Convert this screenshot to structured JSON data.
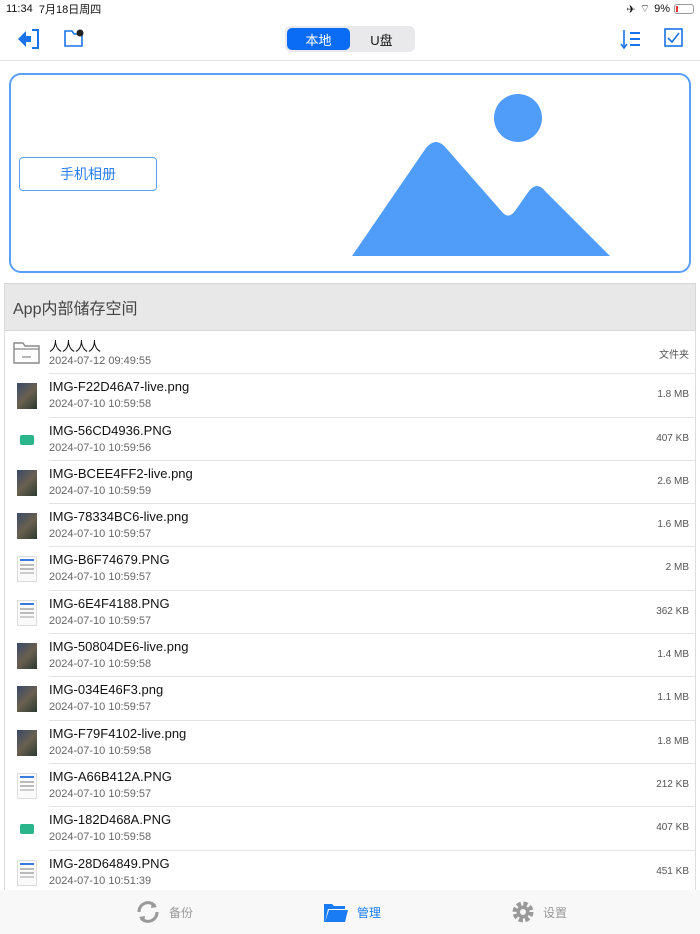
{
  "status": {
    "time": "11:34",
    "date": "7月18日周四",
    "battery": "9%"
  },
  "toolbar": {
    "segments": [
      "本地",
      "U盘"
    ],
    "active_segment": 0
  },
  "album": {
    "button_label": "手机相册"
  },
  "section_title": "App内部储存空间",
  "files": [
    {
      "name": "人人人人",
      "date": "2024-07-12 09:49:55",
      "size": "文件夹",
      "type": "folder"
    },
    {
      "name": "IMG-F22D46A7-live.png",
      "date": "2024-07-10 10:59:58",
      "size": "1.8 MB",
      "type": "photo"
    },
    {
      "name": "IMG-56CD4936.PNG",
      "date": "2024-07-10 10:59:56",
      "size": "407 KB",
      "type": "green"
    },
    {
      "name": "IMG-BCEE4FF2-live.png",
      "date": "2024-07-10 10:59:59",
      "size": "2.6 MB",
      "type": "photo"
    },
    {
      "name": "IMG-78334BC6-live.png",
      "date": "2024-07-10 10:59:57",
      "size": "1.6 MB",
      "type": "photo"
    },
    {
      "name": "IMG-B6F74679.PNG",
      "date": "2024-07-10 10:59:57",
      "size": "2 MB",
      "type": "doc"
    },
    {
      "name": "IMG-6E4F4188.PNG",
      "date": "2024-07-10 10:59:57",
      "size": "362 KB",
      "type": "doc"
    },
    {
      "name": "IMG-50804DE6-live.png",
      "date": "2024-07-10 10:59:58",
      "size": "1.4 MB",
      "type": "photo"
    },
    {
      "name": "IMG-034E46F3.png",
      "date": "2024-07-10 10:59:57",
      "size": "1.1 MB",
      "type": "photo"
    },
    {
      "name": "IMG-F79F4102-live.png",
      "date": "2024-07-10 10:59:58",
      "size": "1.8 MB",
      "type": "photo"
    },
    {
      "name": "IMG-A66B412A.PNG",
      "date": "2024-07-10 10:59:57",
      "size": "212 KB",
      "type": "doc"
    },
    {
      "name": "IMG-182D468A.PNG",
      "date": "2024-07-10 10:59:58",
      "size": "407 KB",
      "type": "green"
    },
    {
      "name": "IMG-28D64849.PNG",
      "date": "2024-07-10 10:51:39",
      "size": "451 KB",
      "type": "doc"
    }
  ],
  "tabs": [
    {
      "label": "备份",
      "icon": "sync-icon"
    },
    {
      "label": "管理",
      "icon": "folder-icon"
    },
    {
      "label": "设置",
      "icon": "gear-icon"
    }
  ],
  "active_tab": 1,
  "colors": {
    "accent": "#0a6cf5",
    "album_border": "#5aa0f7",
    "image_fill": "#4f9cf9"
  }
}
